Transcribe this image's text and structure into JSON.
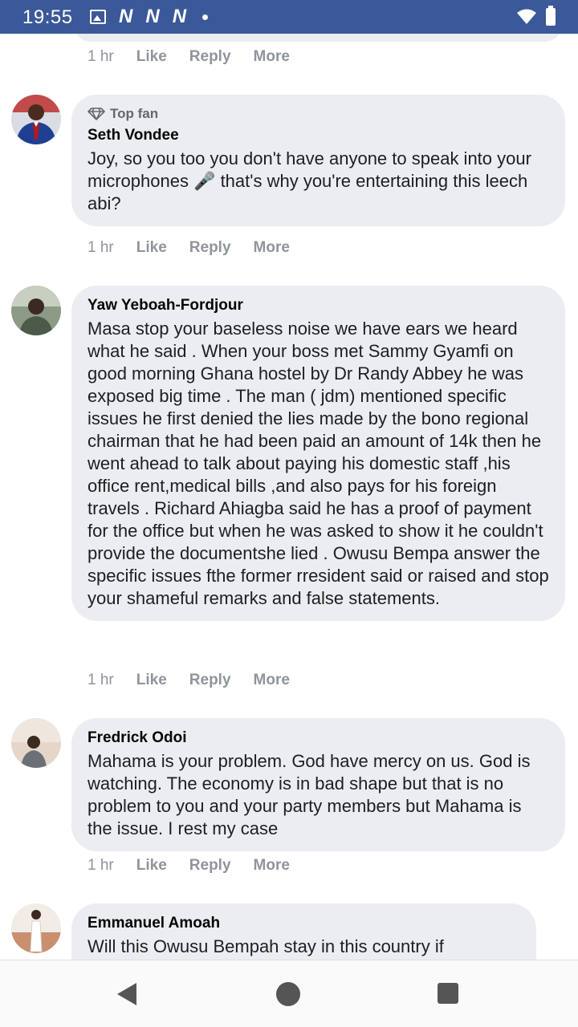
{
  "status_bar": {
    "time": "19:55",
    "notification_icons": [
      "N",
      "N",
      "N"
    ]
  },
  "previous_comment": {
    "time": "1 hr",
    "like": "Like",
    "reply": "Reply",
    "more": "More"
  },
  "comments": [
    {
      "badge": "Top fan",
      "author": "Seth Vondee",
      "text": "Joy, so you too you don't have anyone to speak into your microphones 🎤 that's why you're entertaining this leech abi?",
      "time": "1 hr",
      "like": "Like",
      "reply": "Reply",
      "more": "More"
    },
    {
      "author": "Yaw Yeboah-Fordjour",
      "text": "Masa stop your baseless noise we have ears we heard what he said . When your boss met Sammy Gyamfi on good morning Ghana hostel by Dr Randy Abbey he was exposed big time . The man ( jdm) mentioned specific issues he first denied the lies made by the bono regional chairman that he had been paid an amount of 14k then he went ahead to talk about paying his domestic staff ,his office rent,medical bills ,and also pays for his foreign travels . Richard Ahiagba said he has a proof of payment for the office but when he was asked to show it he couldn't provide the documentshe lied . Owusu Bempa answer the specific issues fthe former rresident said or raised and stop your shameful remarks and false statements.",
      "time": "1 hr",
      "like": "Like",
      "reply": "Reply",
      "more": "More"
    },
    {
      "author": "Fredrick Odoi",
      "text": "Mahama is your problem. God have mercy on us. God is watching. The economy is in bad shape but that is no problem to you and your party members but Mahama is the issue. I rest my case",
      "time": "1 hr",
      "like": "Like",
      "reply": "Reply",
      "more": "More"
    },
    {
      "author": "Emmanuel Amoah",
      "text": "Will this Owusu Bempah stay in this country if"
    }
  ]
}
